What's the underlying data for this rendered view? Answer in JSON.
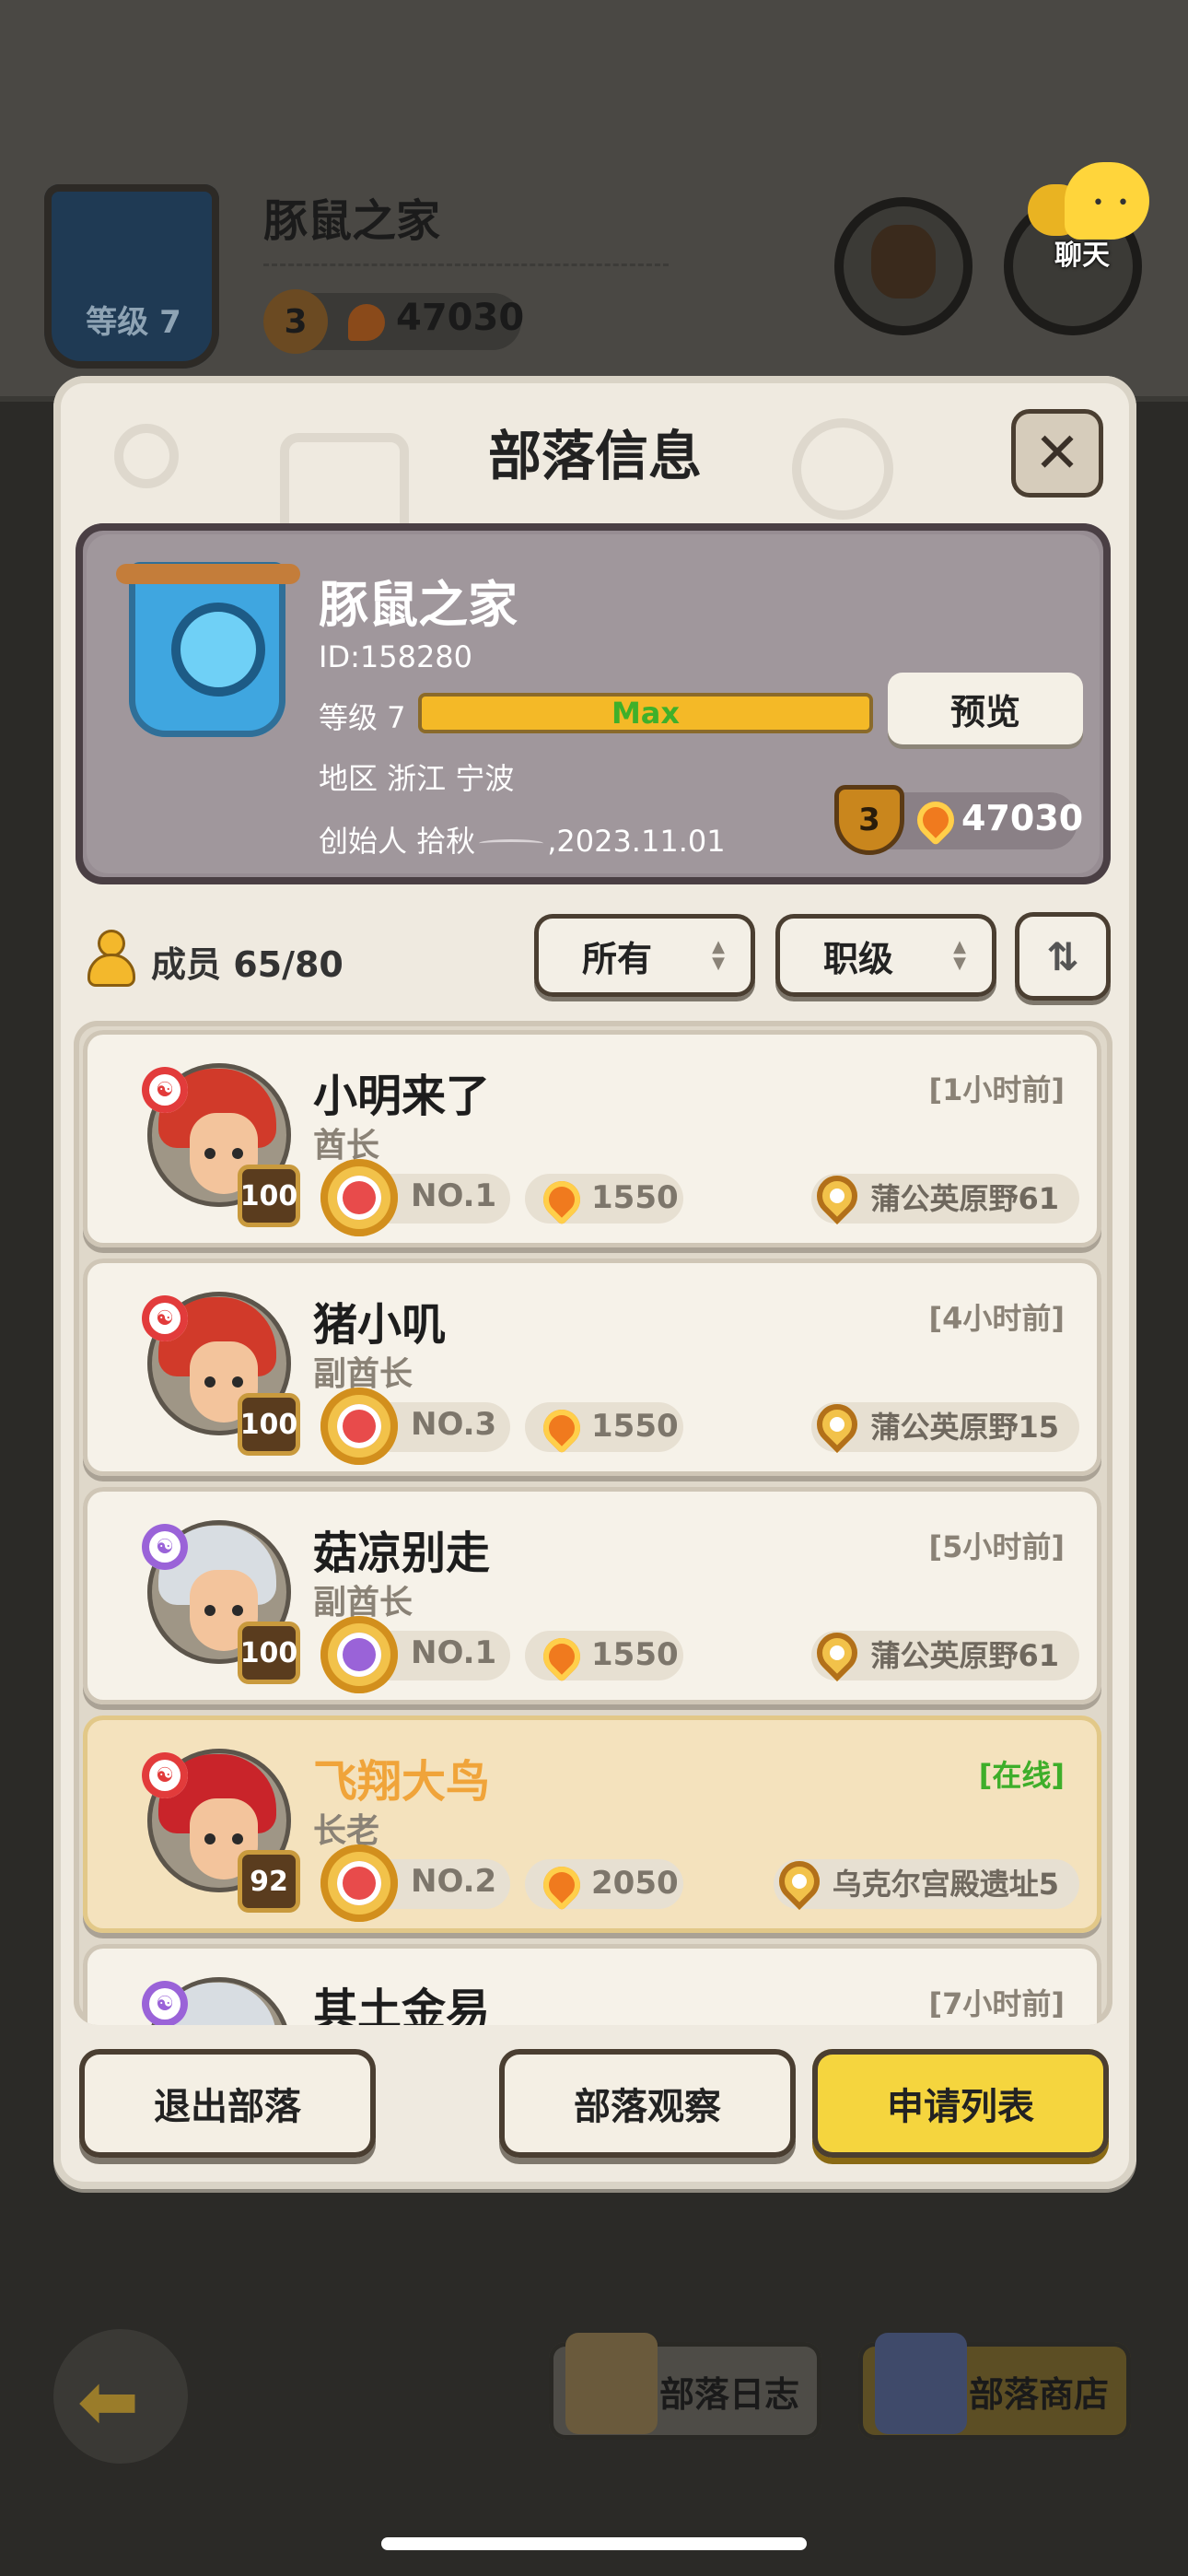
{
  "background": {
    "clan_level": "等级 7",
    "clan_name": "豚鼠之家",
    "rank": "3",
    "score": "47030",
    "chat_label": "聊天"
  },
  "panel": {
    "title": "部落信息",
    "close_icon": "close-icon"
  },
  "clan": {
    "name": "豚鼠之家",
    "id_text": "ID:158280",
    "level_label": "等级 7",
    "level_progress_text": "Max",
    "level_progress": 1.0,
    "region": "地区 浙江 宁波",
    "founder": "创始人 拾秋",
    "founded_date": ",2023.11.01",
    "rank": "3",
    "score": "47030",
    "preview_button": "预览"
  },
  "members_toolbar": {
    "members": "成员 65/80",
    "filter_all": "所有",
    "filter_rank": "职级"
  },
  "members": [
    {
      "name": "小明来了",
      "role": "酋长",
      "time": "[1小时前]",
      "level": "100",
      "rank": "NO.1",
      "score": "1550",
      "location": "蒲公英原野61",
      "class": "red",
      "online": false
    },
    {
      "name": "猪小叽",
      "role": "副酋长",
      "time": "[4小时前]",
      "level": "100",
      "rank": "NO.3",
      "score": "1550",
      "location": "蒲公英原野15",
      "class": "red",
      "online": false
    },
    {
      "name": "菇凉别走",
      "role": "副酋长",
      "time": "[5小时前]",
      "level": "100",
      "rank": "NO.1",
      "score": "1550",
      "location": "蒲公英原野61",
      "class": "purple",
      "online": false
    },
    {
      "name": "飞翔大鸟",
      "role": "长老",
      "time": "[在线]",
      "level": "92",
      "rank": "NO.2",
      "score": "2050",
      "location": "乌克尔宫殿遗址5",
      "class": "red",
      "online": true
    },
    {
      "name": "其土金易",
      "role": "",
      "time": "[7小时前]",
      "level": "",
      "rank": "",
      "score": "",
      "location": "",
      "class": "purple",
      "online": false
    }
  ],
  "actions": {
    "leave": "退出部落",
    "observe": "部落观察",
    "applications": "申请列表"
  },
  "bottom_bar": {
    "log": "部落日志",
    "shop": "部落商店"
  },
  "colors": {
    "accent_yellow": "#f5d53e",
    "online_green": "#3eae2a",
    "gold_name": "#f0a43a",
    "xp_bar": "#f4b927"
  }
}
